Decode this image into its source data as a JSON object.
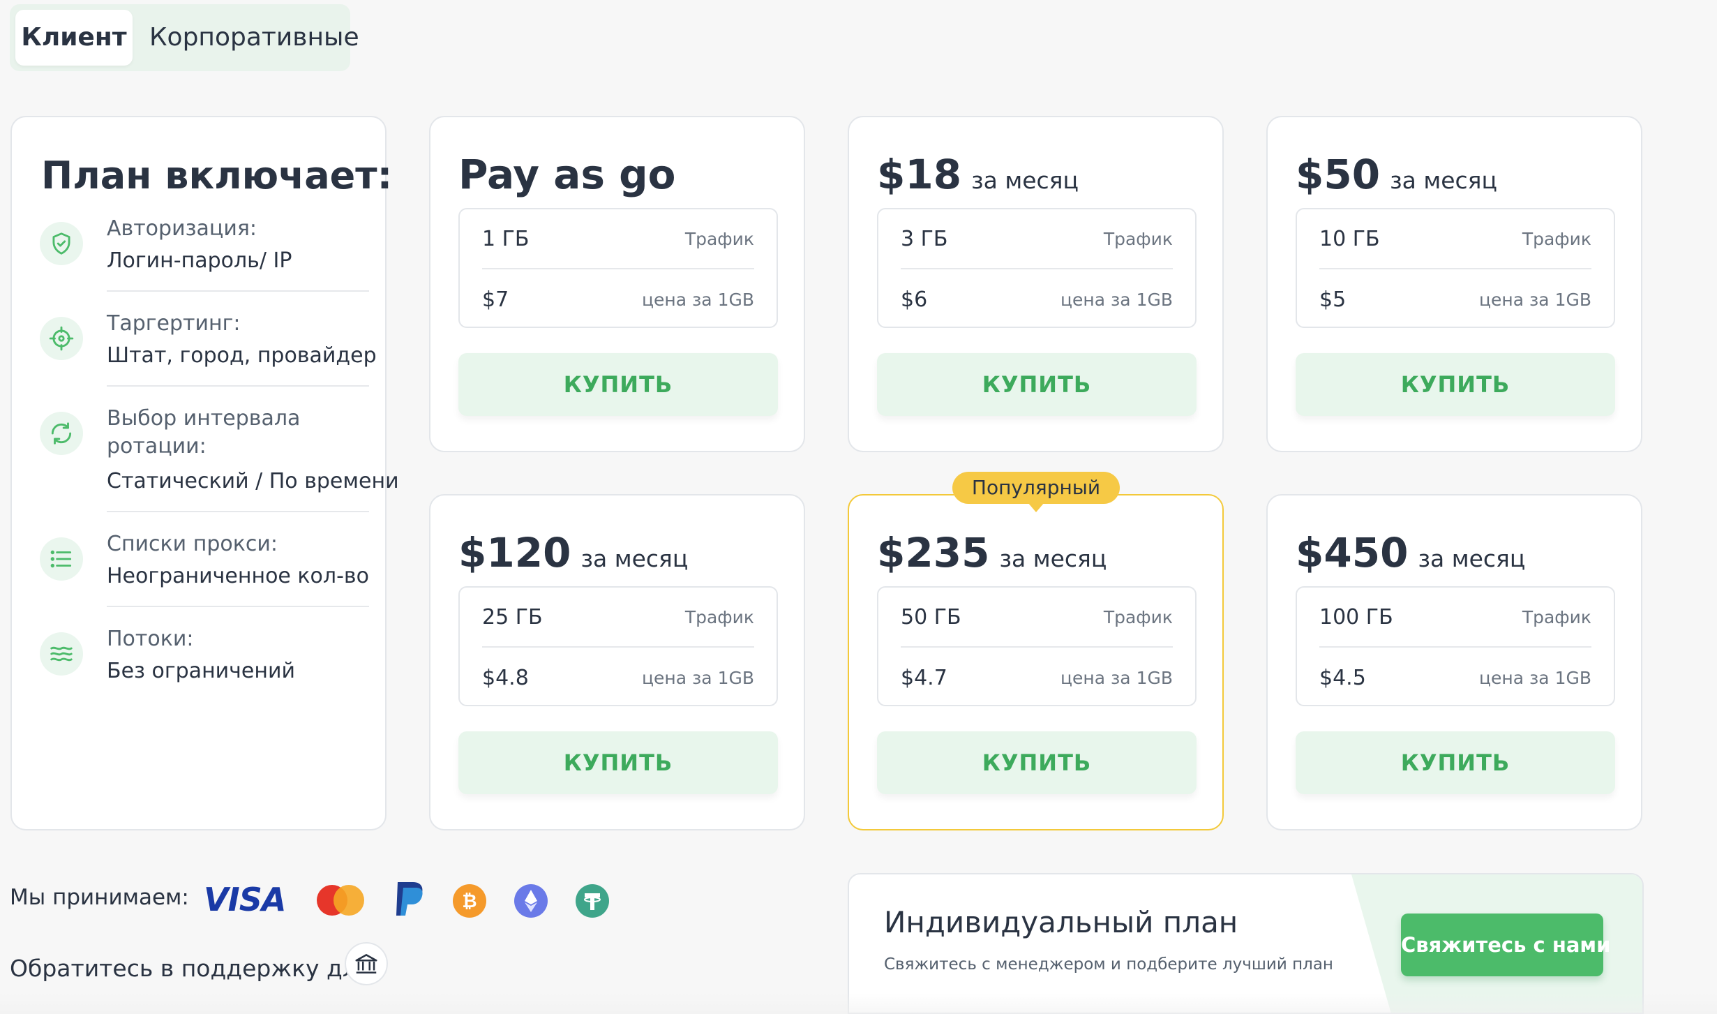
{
  "tabs": {
    "active": "Клиент",
    "inactive": "Корпоративные"
  },
  "features": {
    "title": "План включает:",
    "items": [
      {
        "icon": "shield-check-icon",
        "label": "Авторизация:",
        "value": "Логин-пароль/ IP"
      },
      {
        "icon": "target-icon",
        "label": "Таргертинг:",
        "value": "Штат, город, провайдер"
      },
      {
        "icon": "rotate-icon",
        "label": "Выбор интервала ротации:",
        "value": "Статический / По времени"
      },
      {
        "icon": "list-icon",
        "label": "Списки прокси:",
        "value": "Неограниченное кол-во"
      },
      {
        "icon": "waves-icon",
        "label": "Потоки:",
        "value": "Без ограничений"
      }
    ]
  },
  "plans": [
    {
      "price": "Pay as go",
      "period": "",
      "traffic": "1 ГБ",
      "traffic_label": "Трафик",
      "per_gb": "$7",
      "per_gb_label": "цена за 1GB",
      "button": "КУПИТЬ"
    },
    {
      "price": "$18",
      "period": "за месяц",
      "traffic": "3 ГБ",
      "traffic_label": "Трафик",
      "per_gb": "$6",
      "per_gb_label": "цена за 1GB",
      "button": "КУПИТЬ"
    },
    {
      "price": "$50",
      "period": "за месяц",
      "traffic": "10 ГБ",
      "traffic_label": "Трафик",
      "per_gb": "$5",
      "per_gb_label": "цена за 1GB",
      "button": "КУПИТЬ"
    },
    {
      "price": "$120",
      "period": "за месяц",
      "traffic": "25 ГБ",
      "traffic_label": "Трафик",
      "per_gb": "$4.8",
      "per_gb_label": "цена за 1GB",
      "button": "КУПИТЬ"
    },
    {
      "price": "$235",
      "period": "за месяц",
      "traffic": "50 ГБ",
      "traffic_label": "Трафик",
      "per_gb": "$4.7",
      "per_gb_label": "цена за 1GB",
      "button": "КУПИТЬ"
    },
    {
      "price": "$450",
      "period": "за месяц",
      "traffic": "100 ГБ",
      "traffic_label": "Трафик",
      "per_gb": "$4.5",
      "per_gb_label": "цена за 1GB",
      "button": "КУПИТЬ"
    }
  ],
  "popular_badge": "Популярный",
  "payments": {
    "label": "Мы принимаем:",
    "methods": [
      "visa-icon",
      "mastercard-icon",
      "paypal-icon",
      "bitcoin-icon",
      "ethereum-icon",
      "tether-icon"
    ],
    "visa_text": "VISA"
  },
  "support": {
    "label": "Обратитесь в поддержку для"
  },
  "individual": {
    "title": "Индивидуальный план",
    "subtitle": "Свяжитесь с менеджером и подберите лучший план",
    "button": "Свяжитесь с нами"
  },
  "colors": {
    "accent_green": "#4cbb6a",
    "button_bg": "#e8f6ec",
    "button_text": "#3daa5c",
    "popular": "#f6c945",
    "text": "#2a3342"
  }
}
